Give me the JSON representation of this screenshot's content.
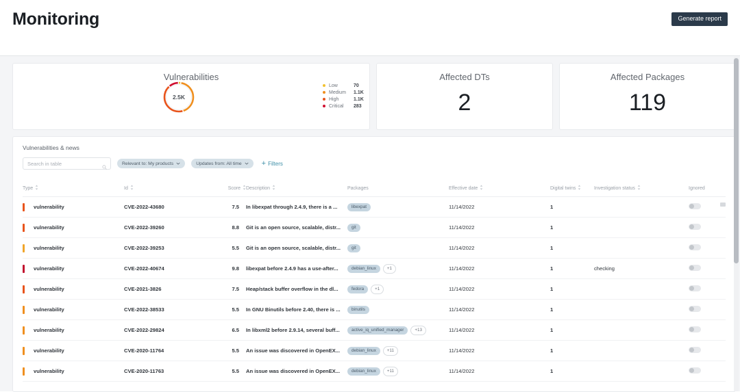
{
  "header": {
    "title": "Monitoring",
    "generate_report_label": "Generate report"
  },
  "cards": {
    "vulnerabilities": {
      "label": "Vulnerabilities",
      "center_value": "2.5K",
      "legend": [
        {
          "name": "Low",
          "value": "70",
          "color": "#f2c230"
        },
        {
          "name": "Medium",
          "value": "1.1K",
          "color": "#ef8f1f"
        },
        {
          "name": "High",
          "value": "1.1K",
          "color": "#e8541c"
        },
        {
          "name": "Critical",
          "value": "283",
          "color": "#d01030"
        }
      ]
    },
    "affected_dts": {
      "label": "Affected DTs",
      "value": "2"
    },
    "affected_packages": {
      "label": "Affected Packages",
      "value": "119"
    }
  },
  "panel": {
    "title": "Vulnerabilities & news",
    "search": {
      "placeholder": "Search in table",
      "value": ""
    },
    "chips": [
      {
        "label": "Relevant to: My products"
      },
      {
        "label": "Updates from: All time"
      }
    ],
    "filters_label": "Filters",
    "columns": [
      {
        "key": "type",
        "label": "Type",
        "sortable": true
      },
      {
        "key": "id",
        "label": "Id",
        "sortable": true
      },
      {
        "key": "score",
        "label": "Score",
        "sortable": true
      },
      {
        "key": "desc",
        "label": "Description",
        "sortable": true
      },
      {
        "key": "packages",
        "label": "Packages",
        "sortable": false
      },
      {
        "key": "eff_date",
        "label": "Effective date",
        "sortable": true
      },
      {
        "key": "dts",
        "label": "Digital twins",
        "sortable": true
      },
      {
        "key": "inv_status",
        "label": "Investigation status",
        "sortable": true
      },
      {
        "key": "ignored",
        "label": "Ignored",
        "sortable": false
      }
    ],
    "rows": [
      {
        "severity_color": "#e8541c",
        "type": "vulnerability",
        "id": "CVE-2022-43680",
        "score": "7.5",
        "desc": "In libexpat through 2.4.9, there is a ...",
        "package": "libexpat",
        "more": "",
        "eff_date": "11/14/2022",
        "dts": "1",
        "inv_status": "",
        "ignored": false
      },
      {
        "severity_color": "#e8541c",
        "type": "vulnerability",
        "id": "CVE-2022-39260",
        "score": "8.8",
        "desc": "Git is an open source, scalable, distr...",
        "package": "git",
        "more": "",
        "eff_date": "11/14/2022",
        "dts": "1",
        "inv_status": "",
        "ignored": false
      },
      {
        "severity_color": "#f0a52a",
        "type": "vulnerability",
        "id": "CVE-2022-39253",
        "score": "5.5",
        "desc": "Git is an open source, scalable, distr...",
        "package": "git",
        "more": "",
        "eff_date": "11/14/2022",
        "dts": "1",
        "inv_status": "",
        "ignored": false
      },
      {
        "severity_color": "#c2102e",
        "type": "vulnerability",
        "id": "CVE-2022-40674",
        "score": "9.8",
        "desc": "libexpat before 2.4.9 has a use-after...",
        "package": "debian_linux",
        "more": "+1",
        "eff_date": "11/14/2022",
        "dts": "1",
        "inv_status": "checking",
        "ignored": false
      },
      {
        "severity_color": "#e8541c",
        "type": "vulnerability",
        "id": "CVE-2021-3826",
        "score": "7.5",
        "desc": "Heap/stack buffer overflow in the dl...",
        "package": "fedora",
        "more": "+1",
        "eff_date": "11/14/2022",
        "dts": "1",
        "inv_status": "",
        "ignored": false
      },
      {
        "severity_color": "#ef8f1f",
        "type": "vulnerability",
        "id": "CVE-2022-38533",
        "score": "5.5",
        "desc": "In GNU Binutils before 2.40, there is ...",
        "package": "binutils",
        "more": "",
        "eff_date": "11/14/2022",
        "dts": "1",
        "inv_status": "",
        "ignored": false
      },
      {
        "severity_color": "#ef8f1f",
        "type": "vulnerability",
        "id": "CVE-2022-29824",
        "score": "6.5",
        "desc": "In libxml2 before 2.9.14, several buff...",
        "package": "active_iq_unified_manager",
        "more": "+13",
        "eff_date": "11/14/2022",
        "dts": "1",
        "inv_status": "",
        "ignored": false
      },
      {
        "severity_color": "#ef8f1f",
        "type": "vulnerability",
        "id": "CVE-2020-11764",
        "score": "5.5",
        "desc": "An issue was discovered in OpenEX...",
        "package": "debian_linux",
        "more": "+11",
        "eff_date": "11/14/2022",
        "dts": "1",
        "inv_status": "",
        "ignored": false
      },
      {
        "severity_color": "#ef8f1f",
        "type": "vulnerability",
        "id": "CVE-2020-11763",
        "score": "5.5",
        "desc": "An issue was discovered in OpenEX...",
        "package": "debian_linux",
        "more": "+11",
        "eff_date": "11/14/2022",
        "dts": "1",
        "inv_status": "",
        "ignored": false
      }
    ]
  },
  "chart_data": {
    "type": "pie",
    "title": "Vulnerabilities",
    "center_label": "2.5K",
    "categories": [
      "Low",
      "Medium",
      "High",
      "Critical"
    ],
    "values": [
      70,
      1100,
      1100,
      283
    ],
    "value_labels": [
      "70",
      "1.1K",
      "1.1K",
      "283"
    ],
    "colors": [
      "#f2c230",
      "#ef8f1f",
      "#e8541c",
      "#d01030"
    ],
    "legend_position": "right",
    "donut": true
  }
}
